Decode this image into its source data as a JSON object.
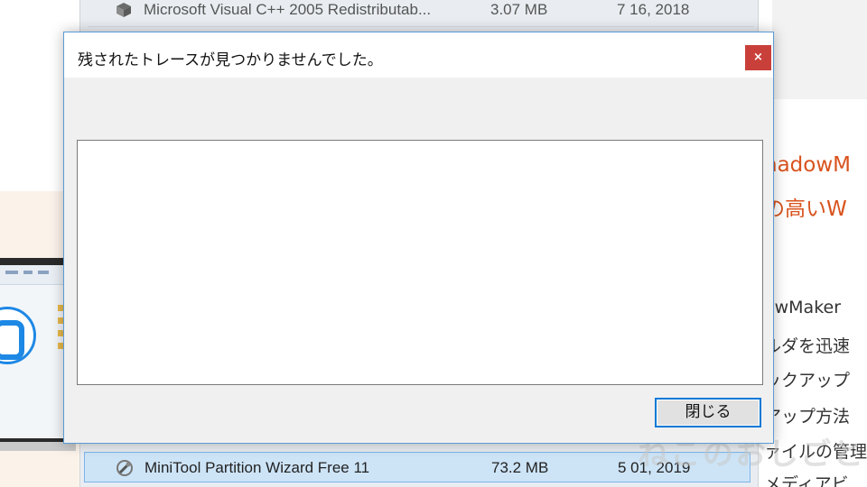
{
  "background_page": {
    "article_lines": [
      "nadowM",
      "の高いW",
      "owMaker",
      "ルダを迅速",
      "ックアップ",
      "アップ方法",
      "ァイルの管理",
      "メディアビ"
    ],
    "watermark": "ねこのおしごと",
    "accent_color": "#d9531e"
  },
  "programs_list": {
    "rows": [
      {
        "name": "Microsoft Visual C++ 2005 Redistributab...",
        "size": "3.07 MB",
        "date": "7 16, 2018",
        "icon": "installer-box-icon",
        "selected": false
      },
      {
        "name": "MiniTool Partition Wizard Free 11",
        "size": "73.2 MB",
        "date": "5 01, 2019",
        "icon": "minitool-wrench-icon",
        "selected": true
      }
    ]
  },
  "dialog": {
    "title": "残されたトレースが見つかりませんでした。",
    "close_label": "×",
    "textarea_value": "",
    "close_button_label": "閉じる",
    "accent_color": "#0078d7",
    "close_color": "#c9403a"
  }
}
